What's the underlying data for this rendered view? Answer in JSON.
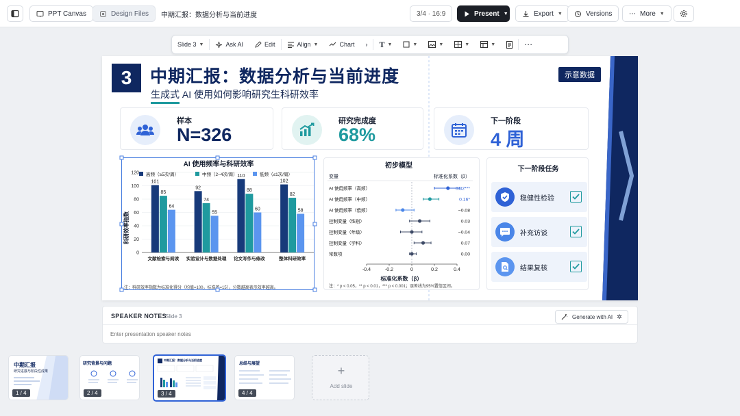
{
  "topbar": {
    "tabs": [
      "PPT Canvas",
      "Design Files"
    ],
    "doc_title": "中期汇报：数据分析与当前进度",
    "slide_info": "3/4 · 16:9",
    "present": "Present",
    "export": "Export",
    "versions": "Versions",
    "more": "More"
  },
  "toolbar": {
    "slide": "Slide 3",
    "ask_ai": "Ask AI",
    "edit": "Edit",
    "align": "Align",
    "chart": "Chart"
  },
  "slide": {
    "number": "3",
    "title": "中期汇报：数据分析与当前进度",
    "subtitle": "生成式 AI 使用如何影响研究生科研效率",
    "badge": "示意数据",
    "kpis": [
      {
        "label": "样本",
        "value": "N=326"
      },
      {
        "label": "研究完成度",
        "value": "68%"
      },
      {
        "label": "下一阶段",
        "value": "4 周"
      }
    ],
    "bar_note": "注：科研效率指数为标准化得分（均值=100，标准差=15），分数越高表示效率越高。",
    "model": {
      "title": "初步模型",
      "col_var": "变量",
      "col_coef": "标准化系数（β）",
      "xlabel": "标准化系数（β）",
      "ticks": [
        "-0.4",
        "-0.2",
        "0",
        "0.2",
        "0.4"
      ],
      "rows": [
        {
          "name": "AI 使用频率（高频）",
          "val": "0.32***",
          "beta": 0.32,
          "lo": 0.2,
          "hi": 0.42,
          "color": "#2f62d6"
        },
        {
          "name": "AI 使用频率（中频）",
          "val": "0.16*",
          "beta": 0.16,
          "lo": 0.1,
          "hi": 0.24,
          "color": "#1e9aa0"
        },
        {
          "name": "AI 使用频率（低频）",
          "val": "−0.08",
          "beta": -0.08,
          "lo": -0.14,
          "hi": 0.02,
          "color": "#4a86e8"
        },
        {
          "name": "控制变量（性别）",
          "val": "0.03",
          "beta": 0.07,
          "lo": -0.02,
          "hi": 0.16,
          "color": "#3d4a66"
        },
        {
          "name": "控制变量（年级）",
          "val": "−0.04",
          "beta": 0.0,
          "lo": -0.1,
          "hi": 0.09,
          "color": "#3d4a66"
        },
        {
          "name": "控制变量（学科）",
          "val": "0.07",
          "beta": 0.1,
          "lo": 0.02,
          "hi": 0.17,
          "color": "#3d4a66"
        },
        {
          "name": "常数项",
          "val": "0.00",
          "beta": 0.0,
          "lo": -0.02,
          "hi": 0.04,
          "color": "#3d4a66"
        }
      ],
      "note": "注：* p < 0.05，** p < 0.01，*** p < 0.001；误差线为95%置信区间。"
    },
    "tasks": {
      "title": "下一阶段任务",
      "items": [
        "稳健性检验",
        "补充访谈",
        "结果复核"
      ]
    }
  },
  "chart_data": {
    "type": "bar",
    "title": "AI 使用频率与科研效率",
    "ylabel": "科研效率指数",
    "xlabel": "",
    "ylim": [
      0,
      120
    ],
    "yticks": [
      0,
      20,
      40,
      60,
      80,
      100,
      120
    ],
    "categories": [
      "文献检索与阅读",
      "实验设计与数据处理",
      "论文写作与修改",
      "整体科研效率"
    ],
    "series": [
      {
        "name": "高频（≥5次/周）",
        "color": "#173a7a",
        "values": [
          101,
          92,
          110,
          102
        ]
      },
      {
        "name": "中频（2–4次/周）",
        "color": "#1f9a9f",
        "values": [
          85,
          74,
          88,
          82
        ]
      },
      {
        "name": "低频（≤1次/周）",
        "color": "#5b95ef",
        "values": [
          64,
          55,
          60,
          58
        ]
      }
    ],
    "grid": true,
    "legend": "top"
  },
  "notes": {
    "header": "SPEAKER NOTES",
    "slide_ref": "Slide 3",
    "generate": "Generate with AI",
    "placeholder": "Enter presentation speaker notes"
  },
  "thumbs": [
    {
      "num": "1 / 4",
      "title": "中期汇报",
      "sub": "研究进展与阶段性成果"
    },
    {
      "num": "2 / 4",
      "title": "研究背景与问题",
      "sub": ""
    },
    {
      "num": "3 / 4",
      "title": "中期汇报：数据分析与当前进度",
      "sub": ""
    },
    {
      "num": "4 / 4",
      "title": "总结与展望",
      "sub": ""
    }
  ],
  "add_slide": "Add slide"
}
